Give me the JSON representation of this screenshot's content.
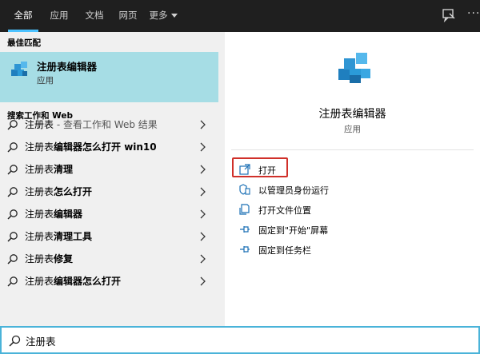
{
  "tabs": [
    {
      "label": "全部"
    },
    {
      "label": "应用"
    },
    {
      "label": "文档"
    },
    {
      "label": "网页"
    },
    {
      "label": "更多"
    }
  ],
  "topbar_icons": [
    "feedback-icon",
    "more-icon"
  ],
  "left": {
    "best_match_header": "最佳匹配",
    "best_match": {
      "title": "注册表编辑器",
      "subtitle": "应用"
    },
    "search_web_header": "搜索工作和 Web",
    "results": [
      {
        "bold": "注册表",
        "suffix": " - 查看工作和 Web 结果"
      },
      {
        "plain": "注册表",
        "bold": "编辑器怎么打开 win10"
      },
      {
        "plain": "注册表",
        "bold": "清理"
      },
      {
        "plain": "注册表",
        "bold": "怎么打开"
      },
      {
        "plain": "注册表",
        "bold": "编辑器"
      },
      {
        "plain": "注册表",
        "bold": "清理工具"
      },
      {
        "plain": "注册表",
        "bold": "修复"
      },
      {
        "plain": "注册表",
        "bold": "编辑器怎么打开"
      }
    ]
  },
  "right": {
    "app_name": "注册表编辑器",
    "app_type": "应用",
    "actions": [
      {
        "label": "打开",
        "icon": "open-icon"
      },
      {
        "label": "以管理员身份运行",
        "icon": "shield-icon"
      },
      {
        "label": "打开文件位置",
        "icon": "file-location-icon"
      },
      {
        "label": "固定到\"开始\"屏幕",
        "icon": "pin-icon"
      },
      {
        "label": "固定到任务栏",
        "icon": "pin-icon"
      }
    ]
  },
  "search": {
    "value": "注册表"
  },
  "colors": {
    "accent": "#4cc2ff",
    "selected": "#a6dde5",
    "highlight_box": "#d0302a",
    "topbar": "#1f1f1f"
  }
}
